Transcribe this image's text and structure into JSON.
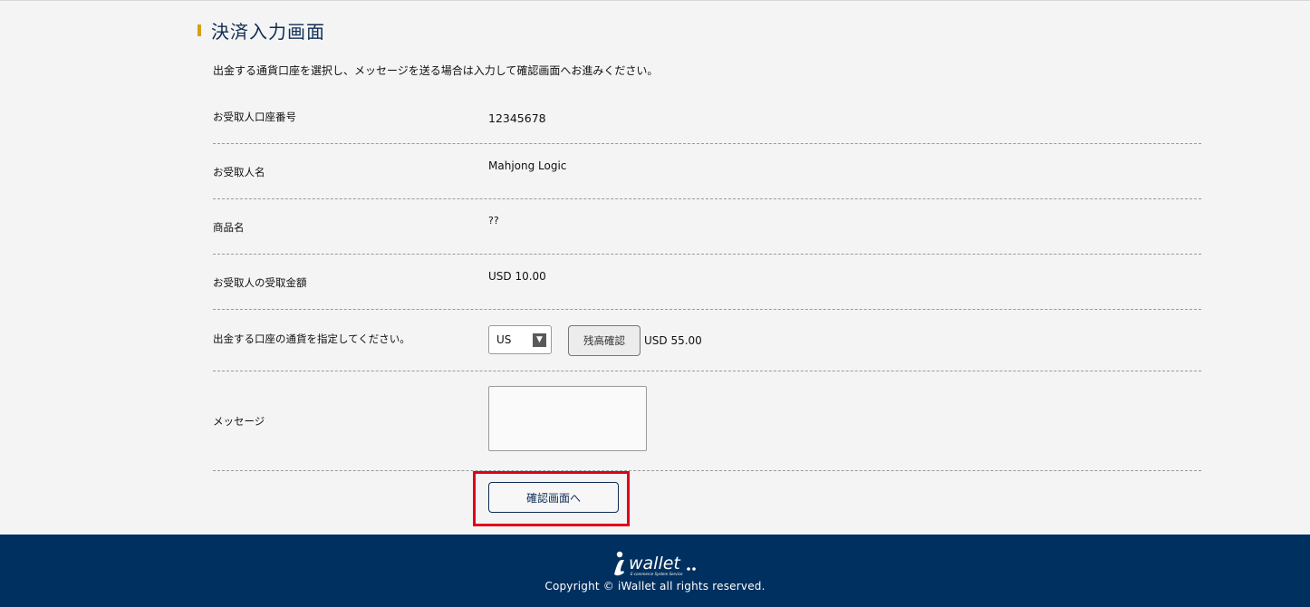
{
  "page": {
    "title": "決済入力画面",
    "instruction": "出金する通貨口座を選択し、メッセージを送る場合は入力して確認画面へお進みください。"
  },
  "form": {
    "recipient_account": {
      "label": "お受取人口座番号",
      "value": "12345678"
    },
    "recipient_name": {
      "label": "お受取人名",
      "value": "Mahjong Logic"
    },
    "product_name": {
      "label": "商品名",
      "value": "??"
    },
    "recipient_amount": {
      "label": "お受取人の受取金額",
      "value": "USD 10.00"
    },
    "currency": {
      "label": "出金する口座の通貨を指定してください。",
      "selected": "US",
      "balance_button": "残高確認",
      "balance_text": "USD 55.00"
    },
    "message": {
      "label": "メッセージ",
      "value": ""
    },
    "submit_label": "確認画面へ"
  },
  "footer": {
    "logo_text": "wallet",
    "logo_subtext": "E-commerce System Service",
    "copyright": "Copyright © iWallet all rights reserved."
  },
  "colors": {
    "accent": "#d4a017",
    "navy": "#00305f",
    "title": "#0f2d55",
    "highlight": "#e0001a"
  },
  "icons": {
    "select_arrow": "chevron-down-icon",
    "logo": "iwallet-logo"
  }
}
